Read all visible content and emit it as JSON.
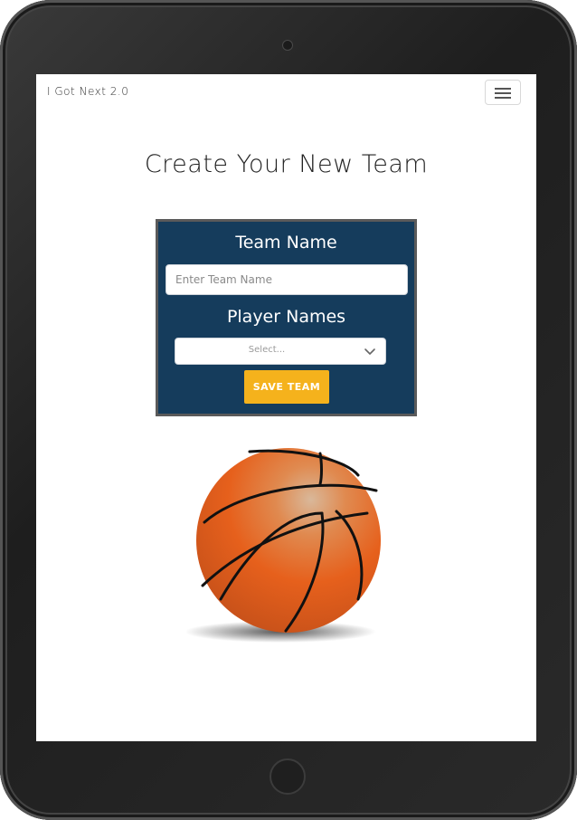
{
  "navbar": {
    "brand": "I Got Next 2.0",
    "menu_icon": "hamburger-icon"
  },
  "main": {
    "title": "Create Your New Team"
  },
  "team_form": {
    "team_name_label": "Team Name",
    "team_name_value": "",
    "team_name_placeholder": "Enter Team Name",
    "player_names_label": "Player Names",
    "player_select_selected": "Select...",
    "player_select_icon": "chevron-down-icon",
    "save_label": "SAVE TEAM"
  },
  "illustration": {
    "icon": "basketball-icon"
  },
  "colors": {
    "card_background": "#153c5c",
    "save_button": "#f5b21c",
    "ball_orange": "#e8641e"
  }
}
